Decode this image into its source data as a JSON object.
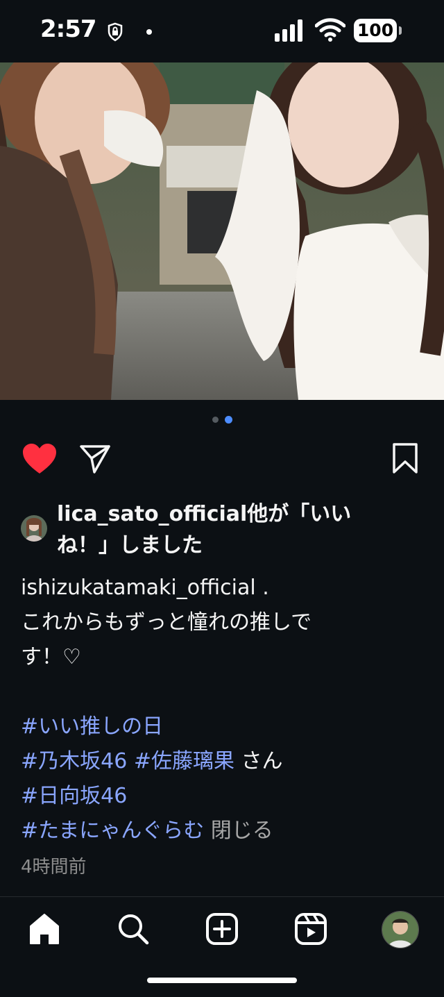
{
  "status_bar": {
    "time": "2:57",
    "battery": "100"
  },
  "post": {
    "image_icon": "person-tag-icon",
    "carousel": {
      "count": 2,
      "active_index": 1,
      "active_color": "#4d8dff",
      "inactive_color": "#555b60"
    },
    "actions": {
      "like_icon": "heart-icon",
      "like_color": "#ff3040",
      "share_icon": "paper-plane-icon",
      "save_icon": "bookmark-icon"
    },
    "liked_by": {
      "line1": "lica_sato_official他が「いい",
      "line2": "ね！」しました"
    },
    "caption": {
      "username": "ishizukatamaki_official",
      "username_suffix": " .",
      "text_line1": "これからもずっと憧れの推しで",
      "text_line2": "す！♡",
      "hashtag1": "#いい推しの日",
      "hashtag2": "#乃木坂46",
      "hashtag3": "#佐藤璃果",
      "mention_suffix": " さん",
      "hashtag4": "#日向坂46",
      "hashtag5": "#たまにゃんぐらむ",
      "collapse": " 閉じる"
    },
    "timestamp": "4時間前"
  },
  "bottom_nav": {
    "items": [
      {
        "icon": "home-icon"
      },
      {
        "icon": "search-icon"
      },
      {
        "icon": "create-post-icon"
      },
      {
        "icon": "reels-icon"
      },
      {
        "icon": "profile-avatar"
      }
    ]
  }
}
